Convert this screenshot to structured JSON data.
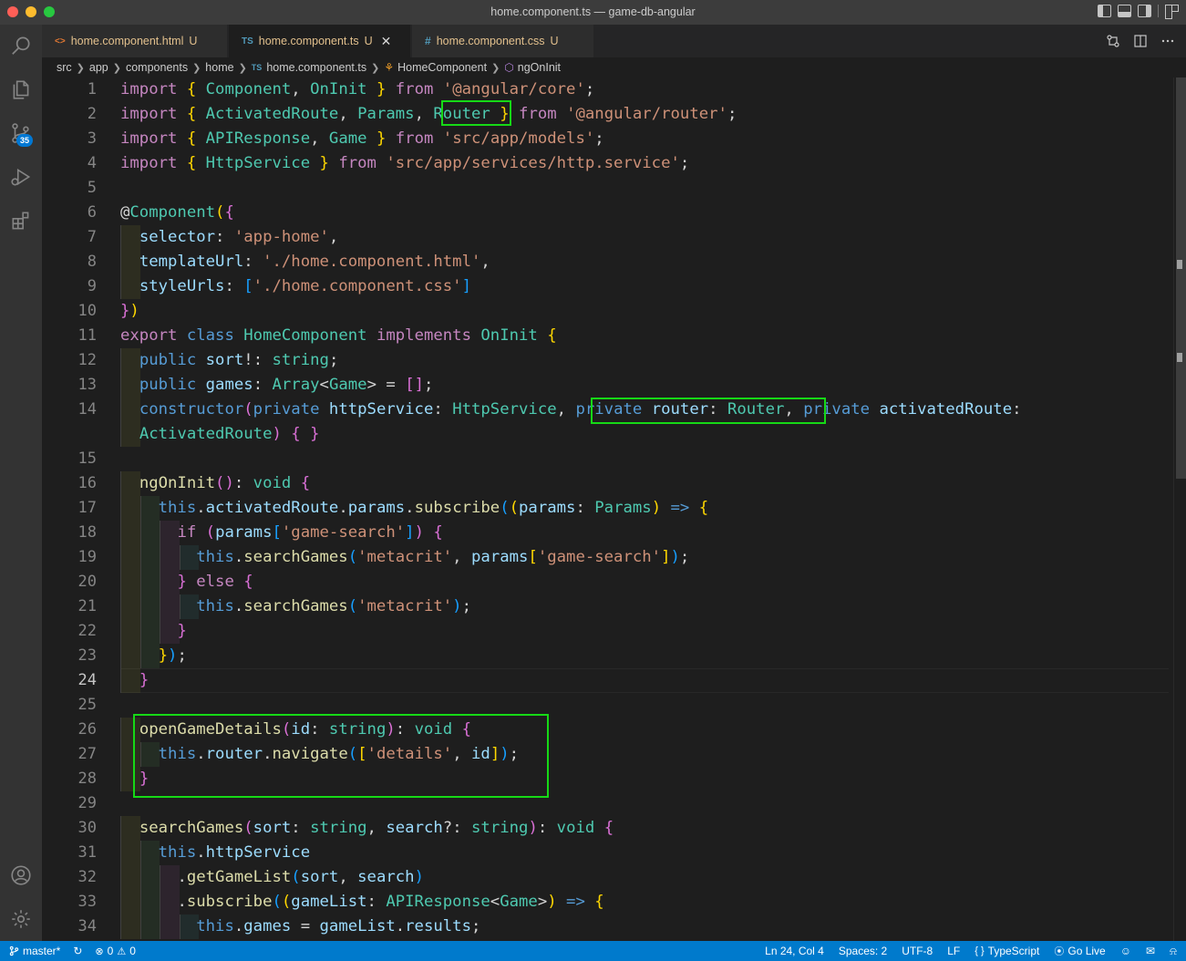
{
  "window": {
    "title": "home.component.ts — game-db-angular"
  },
  "activity_bar": {
    "items": [
      {
        "name": "explorer-search-icon"
      },
      {
        "name": "files-icon"
      },
      {
        "name": "source-control-icon",
        "badge": "35"
      },
      {
        "name": "run-debug-icon"
      },
      {
        "name": "extensions-icon"
      },
      {
        "name": "account-icon"
      },
      {
        "name": "settings-gear-icon"
      }
    ],
    "scm_badge": "35"
  },
  "tabs": [
    {
      "icon": "<>",
      "label": "home.component.html",
      "modified": "U",
      "active": false
    },
    {
      "icon": "TS",
      "label": "home.component.ts",
      "modified": "U",
      "active": true,
      "close": "✕"
    },
    {
      "icon": "#",
      "label": "home.component.css",
      "modified": "U",
      "active": false
    }
  ],
  "breadcrumb": {
    "items": [
      "src",
      "app",
      "components",
      "home",
      "home.component.ts",
      "HomeComponent",
      "ngOnInit"
    ],
    "file_icon": "TS"
  },
  "editor": {
    "language": "TypeScript",
    "current_line": "24",
    "line_numbers": [
      "1",
      "2",
      "3",
      "4",
      "5",
      "6",
      "7",
      "8",
      "9",
      "10",
      "11",
      "12",
      "13",
      "14",
      "15",
      "16",
      "17",
      "18",
      "19",
      "20",
      "21",
      "22",
      "23",
      "24",
      "25",
      "26",
      "27",
      "28",
      "29",
      "30",
      "31",
      "32",
      "33",
      "34"
    ]
  },
  "code_lines": [
    "import { Component, OnInit } from '@angular/core';",
    "import { ActivatedRoute, Params, Router } from '@angular/router';",
    "import { APIResponse, Game } from 'src/app/models';",
    "import { HttpService } from 'src/app/services/http.service';",
    "",
    "@Component({",
    "  selector: 'app-home',",
    "  templateUrl: './home.component.html',",
    "  styleUrls: ['./home.component.css']",
    "})",
    "export class HomeComponent implements OnInit {",
    "  public sort!: string;",
    "  public games: Array<Game> = [];",
    "  constructor(private httpService: HttpService, private router: Router, private activatedRoute:",
    "  ActivatedRoute) { }",
    "",
    "  ngOnInit(): void {",
    "    this.activatedRoute.params.subscribe((params: Params) => {",
    "      if (params['game-search']) {",
    "        this.searchGames('metacrit', params['game-search']);",
    "      } else {",
    "        this.searchGames('metacrit');",
    "      }",
    "    });",
    "  }",
    "",
    "  openGameDetails(id: string): void {",
    "    this.router.navigate(['details', id]);",
    "  }",
    "",
    "  searchGames(sort: string, search?: string): void {",
    "    this.httpService",
    "      .getGameList(sort, search)",
    "      .subscribe((gameList: APIResponse<Game>) => {",
    "        this.games = gameList.results;"
  ],
  "status_bar": {
    "branch": "master*",
    "sync_icon": "sync-icon",
    "errors": "0",
    "warnings": "0",
    "position": "Ln 24, Col 4",
    "spaces": "Spaces: 2",
    "encoding": "UTF-8",
    "eol": "LF",
    "language_braces": "{ }",
    "language": "TypeScript",
    "go_live": "Go Live"
  },
  "colors": {
    "highlight_box": "#16d916",
    "status_bar": "#007acc",
    "keyword": "#c586c0",
    "storage": "#569cd6",
    "variable": "#9cdcfe",
    "type": "#4ec9b0",
    "string": "#ce9178",
    "function": "#dcdcaa"
  }
}
